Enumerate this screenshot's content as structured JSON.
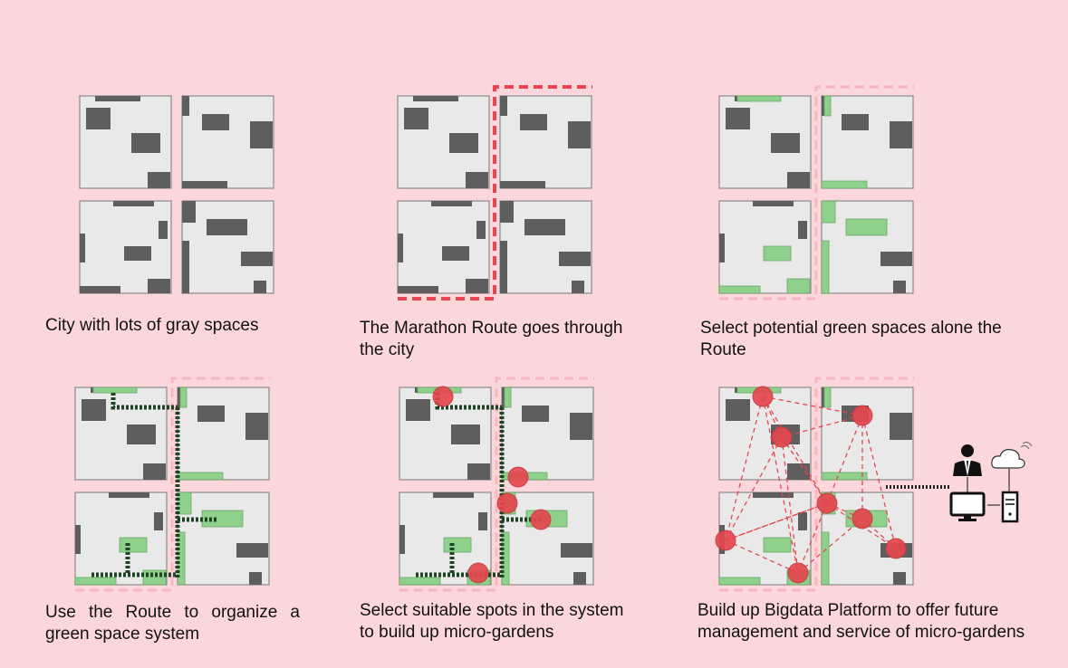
{
  "panels": [
    {
      "id": "gray-city",
      "caption": "City with lots of gray spaces"
    },
    {
      "id": "marathon-route",
      "caption": "The Marathon Route goes through\nthe city"
    },
    {
      "id": "potential-green",
      "caption": "Select potential green spaces alone the\nRoute"
    },
    {
      "id": "green-system",
      "caption": "Use the Route to organize a green space system"
    },
    {
      "id": "micro-gardens",
      "caption": "Select  suitable spots in the system\nto build up micro-gardens"
    },
    {
      "id": "bigdata",
      "caption": "Build up Bigdata Platform to offer future\nmanagement and service of micro-gardens"
    }
  ],
  "colors": {
    "background": "#fbd6da",
    "block": "#e9e9e9",
    "block_outline": "#8a8a8a",
    "building": "#5e5e5e",
    "green_space": "#8fd08c",
    "route_red": "#e5474f",
    "route_faded": "#f7b8bd",
    "route_green": "#1f4424",
    "garden_node": "#e5474f"
  },
  "icons": [
    "user-icon",
    "cloud-icon",
    "monitor-icon",
    "server-tower-icon"
  ]
}
